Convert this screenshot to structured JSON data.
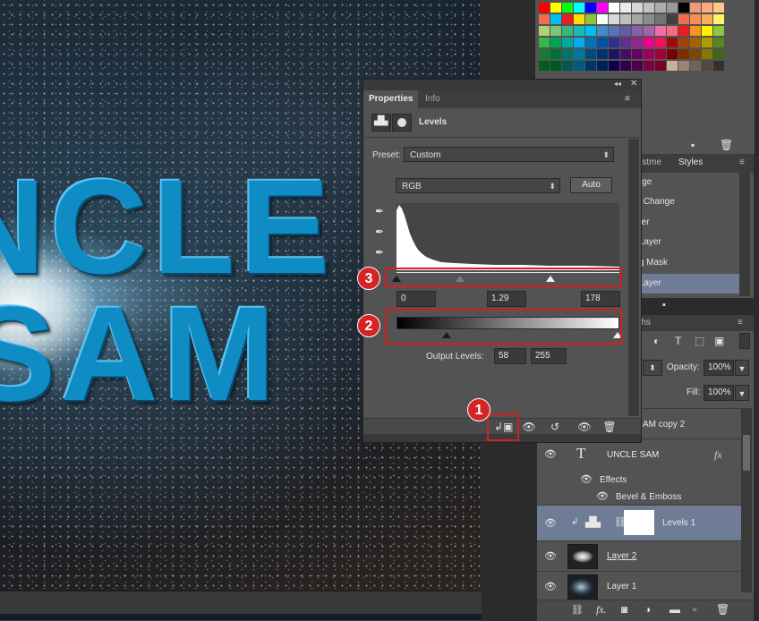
{
  "canvas": {
    "text_line1": "NCLE",
    "text_line2": "SAM"
  },
  "properties_panel": {
    "tabs": [
      "Properties",
      "Info"
    ],
    "title": "Levels",
    "preset_label": "Preset:",
    "preset_value": "Custom",
    "channel_value": "RGB",
    "auto_label": "Auto",
    "input_levels": {
      "black": "0",
      "gamma": "1.29",
      "white": "178"
    },
    "output_label": "Output Levels:",
    "output_levels": {
      "black": "58",
      "white": "255"
    }
  },
  "callouts": [
    "1",
    "2",
    "3"
  ],
  "adjustments_panel": {
    "tabs": [
      "djustme",
      "Styles"
    ],
    "items": [
      "ange",
      "ity Change",
      "ayer",
      "s Layer",
      "ing Mask",
      "s Layer"
    ],
    "selected_index": 5
  },
  "layers_panel": {
    "tab_label": "aths",
    "opacity_label": "Opacity:",
    "opacity_value": "100%",
    "fill_label": "Fill:",
    "fill_value": "100%",
    "layers": [
      {
        "name": "AM copy 2"
      },
      {
        "name": "UNCLE SAM"
      },
      {
        "name": "Effects"
      },
      {
        "name": "Bevel & Emboss"
      },
      {
        "name": "Levels 1"
      },
      {
        "name": "Layer 2"
      },
      {
        "name": "Layer 1"
      }
    ],
    "fx_label": "fx"
  },
  "colors": {
    "accent_red": "#d42424",
    "selection": "#6e7c96",
    "panel_bg": "#535353",
    "text_blue": "#0f8cc4"
  },
  "icons": [
    "eyedropper-icon",
    "eye-icon",
    "clip-to-layer-icon",
    "reset-icon",
    "visibility-icon",
    "trash-icon",
    "chain-icon",
    "text-layer-icon",
    "new-layer-icon",
    "folder-icon",
    "mask-icon",
    "fx-icon",
    "link-icon"
  ]
}
